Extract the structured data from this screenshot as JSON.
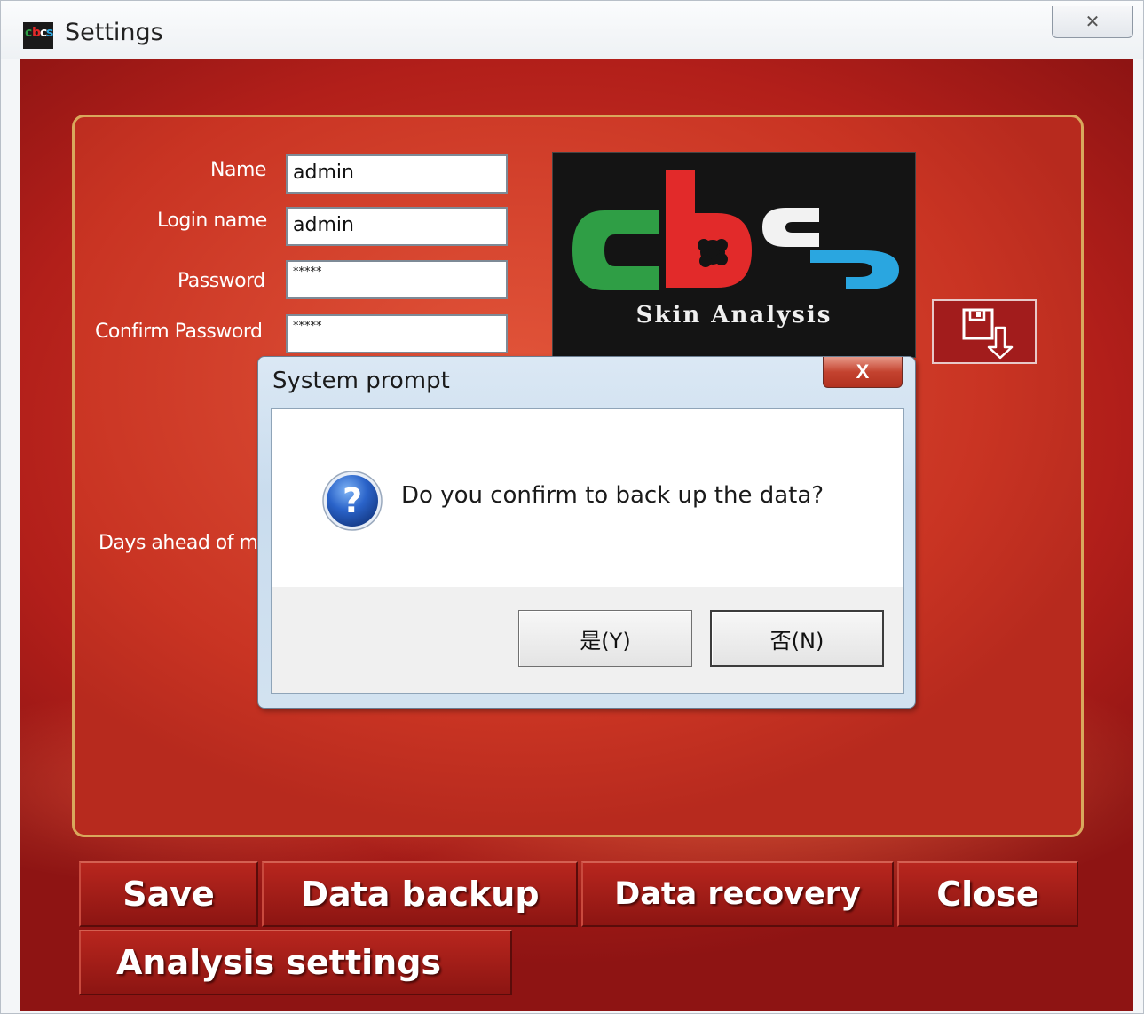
{
  "window": {
    "title": "Settings",
    "close_glyph": "✕",
    "app_icon": "cbcs-logo-icon"
  },
  "form": {
    "name_label": "Name",
    "name_value": "admin",
    "login_label": "Login name",
    "login_value": "admin",
    "password_label": "Password",
    "password_value": "*****",
    "confirm_label": "Confirm Password",
    "confirm_value": "*****",
    "days_label": "Days ahead of m"
  },
  "logo": {
    "tagline": "Skin Analysis",
    "brand_colors": [
      "#2f9e45",
      "#e22a2a",
      "#f2f2f2",
      "#2aa6e0"
    ]
  },
  "buttons": {
    "save": "Save",
    "data_backup": "Data backup",
    "data_recovery": "Data recovery",
    "close": "Close",
    "analysis_settings": "Analysis settings"
  },
  "dialog": {
    "title": "System prompt",
    "close_glyph": "X",
    "message": "Do you confirm to back up the data?",
    "icon": "question-icon",
    "yes_label": "是(Y)",
    "no_label": "否(N)"
  },
  "colors": {
    "panel_border": "#d9a85c",
    "button_red": "#a01c18",
    "background_red": "#c02b1f"
  }
}
